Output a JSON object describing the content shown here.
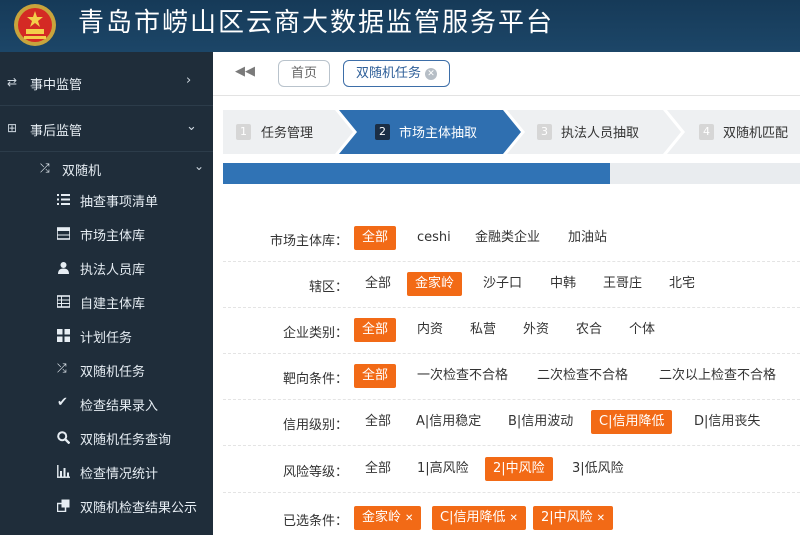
{
  "header": {
    "title": "青岛市崂山区云商大数据监管服务平台"
  },
  "sidebar": {
    "top_items": [
      {
        "label": "事中监管",
        "icon": "arrows-exchange-icon"
      },
      {
        "label": "事后监管",
        "icon": "plus-square-icon"
      }
    ],
    "group": {
      "label": "双随机",
      "icon": "shuffle-icon"
    },
    "leaves": [
      {
        "label": "抽查事项清单",
        "icon": "list-icon"
      },
      {
        "label": "市场主体库",
        "icon": "table-icon"
      },
      {
        "label": "执法人员库",
        "icon": "user-icon"
      },
      {
        "label": "自建主体库",
        "icon": "grid-table-icon"
      },
      {
        "label": "计划任务",
        "icon": "th-large-icon"
      },
      {
        "label": "双随机任务",
        "icon": "shuffle-icon"
      },
      {
        "label": "检查结果录入",
        "icon": "check-icon"
      },
      {
        "label": "双随机任务查询",
        "icon": "search-icon"
      },
      {
        "label": "检查情况统计",
        "icon": "bar-chart-icon"
      },
      {
        "label": "双随机检查结果公示",
        "icon": "clone-icon"
      }
    ]
  },
  "tabs": {
    "back": "◀◀",
    "home": "首页",
    "current": "双随机任务"
  },
  "steps": [
    {
      "num": "1",
      "label": "任务管理"
    },
    {
      "num": "2",
      "label": "市场主体抽取"
    },
    {
      "num": "3",
      "label": "执法人员抽取"
    },
    {
      "num": "4",
      "label": "双随机匹配"
    }
  ],
  "progress": {
    "fraction": 0.67
  },
  "filters": {
    "market": {
      "label": "市场主体库：",
      "options": [
        "全部",
        "ceshi",
        "金融类企业",
        "加油站"
      ]
    },
    "district": {
      "label": "辖区：",
      "options": [
        "全部",
        "金家岭",
        "沙子口",
        "中韩",
        "王哥庄",
        "北宅"
      ]
    },
    "enterprise": {
      "label": "企业类别：",
      "options": [
        "全部",
        "内资",
        "私营",
        "外资",
        "农合",
        "个体"
      ]
    },
    "target": {
      "label": "靶向条件：",
      "options": [
        "全部",
        "一次检查不合格",
        "二次检查不合格",
        "二次以上检查不合格"
      ]
    },
    "credit": {
      "label": "信用级别：",
      "options": [
        "全部",
        "A|信用稳定",
        "B|信用波动",
        "C|信用降低",
        "D|信用丧失"
      ]
    },
    "risk": {
      "label": "风险等级：",
      "options": [
        "全部",
        "1|高风险",
        "2|中风险",
        "3|低风险"
      ]
    },
    "selected": {
      "label": "已选条件：",
      "chips": [
        "金家岭",
        "C|信用降低",
        "2|中风险"
      ]
    }
  },
  "colors": {
    "accent": "#f26a16",
    "brand": "#1c4668",
    "step_active": "#2f6fb0",
    "sidebar": "#1f2d3a"
  }
}
